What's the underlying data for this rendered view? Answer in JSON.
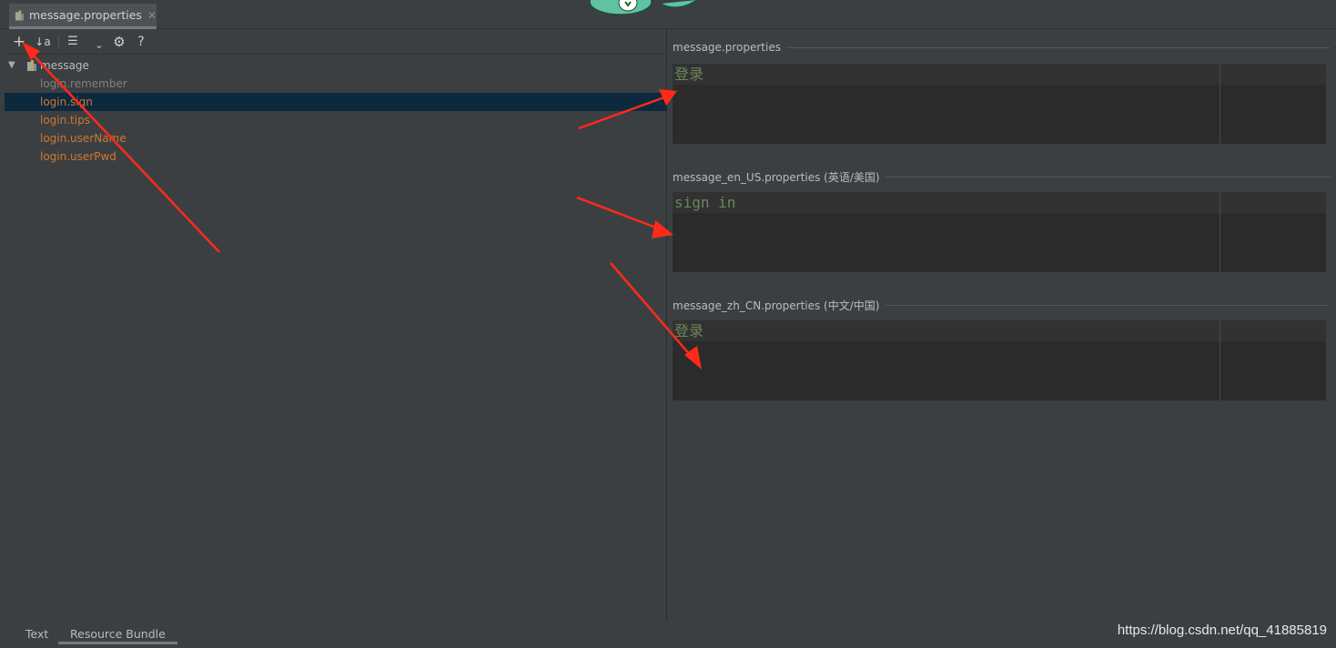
{
  "tab": {
    "label": "message.properties",
    "close": "✕"
  },
  "toolbar": {
    "add": "+",
    "sort": "↓a",
    "group": "☰",
    "dropdown": "⌄",
    "settings": "⚙",
    "help": "?"
  },
  "tree": {
    "root": "message",
    "keys": [
      {
        "label": "login.remember",
        "unused": true,
        "selected": false
      },
      {
        "label": "login.sign",
        "unused": false,
        "selected": true
      },
      {
        "label": "login.tips",
        "unused": false,
        "selected": false
      },
      {
        "label": "login.userName",
        "unused": false,
        "selected": false
      },
      {
        "label": "login.userPwd",
        "unused": false,
        "selected": false
      }
    ]
  },
  "editors": [
    {
      "title": "message.properties",
      "value": "登录"
    },
    {
      "title": "message_en_US.properties (英语/美国)",
      "value": "sign in"
    },
    {
      "title": "message_zh_CN.properties (中文/中国)",
      "value": "登录"
    }
  ],
  "bottom_tabs": {
    "text": "Text",
    "bundle": "Resource Bundle"
  },
  "watermark": "https://blog.csdn.net/qq_41885819",
  "colors": {
    "background": "#3c3f41",
    "editor_bg": "#2b2b2b",
    "key_text": "#cc7832",
    "value_text": "#6a8759",
    "selection": "#0d293e",
    "annotation_arrow": "#ff2a1a"
  }
}
